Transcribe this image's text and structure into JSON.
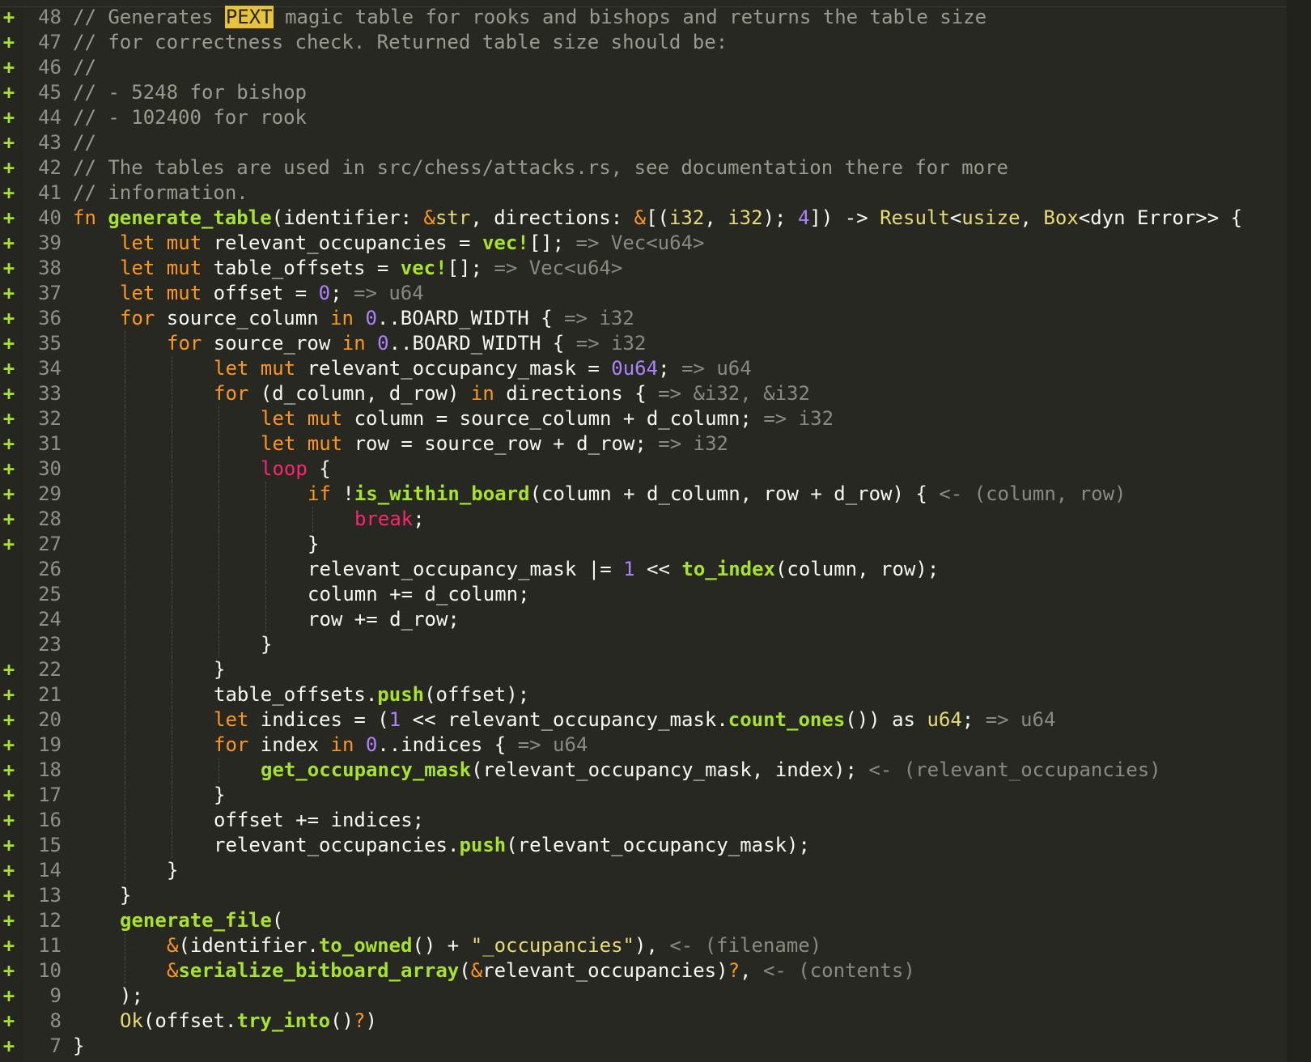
{
  "editor": {
    "colors": {
      "background": "#272822",
      "added_marker": "#a6e22e",
      "keyword": "#f92672",
      "function": "#a6e22e",
      "type": "#e6db74",
      "number": "#ae81ff",
      "comment": "#9a9a8e",
      "highlight": "#e6c33a"
    },
    "lines": [
      {
        "num": "48",
        "mark": "+",
        "indent": 0,
        "tokens": [
          [
            "com",
            "// Generates "
          ],
          [
            "hl",
            "PEXT"
          ],
          [
            "com",
            " magic table for rooks and bishops and returns the table size"
          ]
        ]
      },
      {
        "num": "47",
        "mark": "+",
        "indent": 0,
        "tokens": [
          [
            "com",
            "// for correctness check. Returned table size should be:"
          ]
        ]
      },
      {
        "num": "46",
        "mark": "+",
        "indent": 0,
        "tokens": [
          [
            "com",
            "//"
          ]
        ]
      },
      {
        "num": "45",
        "mark": "+",
        "indent": 0,
        "tokens": [
          [
            "com",
            "// - 5248 for bishop"
          ]
        ]
      },
      {
        "num": "44",
        "mark": "+",
        "indent": 0,
        "tokens": [
          [
            "com",
            "// - 102400 for rook"
          ]
        ]
      },
      {
        "num": "43",
        "mark": "+",
        "indent": 0,
        "tokens": [
          [
            "com",
            "//"
          ]
        ]
      },
      {
        "num": "42",
        "mark": "+",
        "indent": 0,
        "tokens": [
          [
            "com",
            "// The tables are used in src/chess/attacks.rs, see documentation there for more"
          ]
        ]
      },
      {
        "num": "41",
        "mark": "+",
        "indent": 0,
        "tokens": [
          [
            "com",
            "// information."
          ]
        ]
      },
      {
        "num": "40",
        "mark": "+",
        "indent": 0,
        "tokens": [
          [
            "kw2",
            "fn "
          ],
          [
            "fn",
            "generate_table"
          ],
          [
            "plain",
            "(identifier: "
          ],
          [
            "kw2",
            "&"
          ],
          [
            "ty",
            "str"
          ],
          [
            "plain",
            ", directions: "
          ],
          [
            "kw2",
            "&"
          ],
          [
            "plain",
            "[("
          ],
          [
            "ty",
            "i32"
          ],
          [
            "plain",
            ", "
          ],
          [
            "ty",
            "i32"
          ],
          [
            "plain",
            "); "
          ],
          [
            "num",
            "4"
          ],
          [
            "plain",
            "]) -> "
          ],
          [
            "ty",
            "Result"
          ],
          [
            "plain",
            "<"
          ],
          [
            "ty",
            "usize"
          ],
          [
            "plain",
            ", "
          ],
          [
            "ty",
            "Box"
          ],
          [
            "plain",
            "<dyn Error>> {"
          ]
        ]
      },
      {
        "num": "39",
        "mark": "+",
        "indent": 1,
        "tokens": [
          [
            "kw2",
            "let mut "
          ],
          [
            "plain",
            "relevant_occupancies = "
          ],
          [
            "fn",
            "vec!"
          ],
          [
            "plain",
            "[]; "
          ],
          [
            "hint",
            "=> Vec<u64>"
          ]
        ]
      },
      {
        "num": "38",
        "mark": "+",
        "indent": 1,
        "tokens": [
          [
            "kw2",
            "let mut "
          ],
          [
            "plain",
            "table_offsets = "
          ],
          [
            "fn",
            "vec!"
          ],
          [
            "plain",
            "[]; "
          ],
          [
            "hint",
            "=> Vec<u64>"
          ]
        ]
      },
      {
        "num": "37",
        "mark": "+",
        "indent": 1,
        "tokens": [
          [
            "kw2",
            "let mut "
          ],
          [
            "plain",
            "offset = "
          ],
          [
            "num",
            "0"
          ],
          [
            "plain",
            "; "
          ],
          [
            "hint",
            "=> u64"
          ]
        ]
      },
      {
        "num": "36",
        "mark": "+",
        "indent": 1,
        "tokens": [
          [
            "kw2",
            "for "
          ],
          [
            "plain",
            "source_column "
          ],
          [
            "kw2",
            "in "
          ],
          [
            "num",
            "0"
          ],
          [
            "plain",
            "..BOARD_WIDTH { "
          ],
          [
            "hint",
            "=> i32"
          ]
        ]
      },
      {
        "num": "35",
        "mark": "+",
        "indent": 2,
        "tokens": [
          [
            "kw2",
            "for "
          ],
          [
            "plain",
            "source_row "
          ],
          [
            "kw2",
            "in "
          ],
          [
            "num",
            "0"
          ],
          [
            "plain",
            "..BOARD_WIDTH { "
          ],
          [
            "hint",
            "=> i32"
          ]
        ]
      },
      {
        "num": "34",
        "mark": "+",
        "indent": 3,
        "tokens": [
          [
            "kw2",
            "let mut "
          ],
          [
            "plain",
            "relevant_occupancy_mask = "
          ],
          [
            "num",
            "0u64"
          ],
          [
            "plain",
            "; "
          ],
          [
            "hint",
            "=> u64"
          ]
        ]
      },
      {
        "num": "33",
        "mark": "+",
        "indent": 3,
        "tokens": [
          [
            "kw2",
            "for "
          ],
          [
            "plain",
            "(d_column, d_row) "
          ],
          [
            "kw2",
            "in "
          ],
          [
            "plain",
            "directions { "
          ],
          [
            "hint",
            "=> &i32, &i32"
          ]
        ]
      },
      {
        "num": "32",
        "mark": "+",
        "indent": 4,
        "tokens": [
          [
            "kw2",
            "let mut "
          ],
          [
            "plain",
            "column = source_column + d_column; "
          ],
          [
            "hint",
            "=> i32"
          ]
        ]
      },
      {
        "num": "31",
        "mark": "+",
        "indent": 4,
        "tokens": [
          [
            "kw2",
            "let mut "
          ],
          [
            "plain",
            "row = source_row + d_row; "
          ],
          [
            "hint",
            "=> i32"
          ]
        ]
      },
      {
        "num": "30",
        "mark": "+",
        "indent": 4,
        "tokens": [
          [
            "kw",
            "loop "
          ],
          [
            "plain",
            "{"
          ]
        ]
      },
      {
        "num": "29",
        "mark": "+",
        "indent": 5,
        "tokens": [
          [
            "kw2",
            "if "
          ],
          [
            "plain",
            "!"
          ],
          [
            "fn",
            "is_within_board"
          ],
          [
            "plain",
            "(column + d_column, row + d_row) { "
          ],
          [
            "hint",
            "<- (column, row)"
          ]
        ]
      },
      {
        "num": "28",
        "mark": "+",
        "indent": 6,
        "tokens": [
          [
            "kw",
            "break"
          ],
          [
            "plain",
            ";"
          ]
        ]
      },
      {
        "num": "27",
        "mark": "+",
        "indent": 5,
        "tokens": [
          [
            "plain",
            "}"
          ]
        ]
      },
      {
        "num": "26",
        "mark": "",
        "indent": 5,
        "tokens": [
          [
            "plain",
            "relevant_occupancy_mask |= "
          ],
          [
            "num",
            "1"
          ],
          [
            "plain",
            " << "
          ],
          [
            "fn",
            "to_index"
          ],
          [
            "plain",
            "(column, row);"
          ]
        ]
      },
      {
        "num": "25",
        "mark": "",
        "indent": 5,
        "tokens": [
          [
            "plain",
            "column += d_column;"
          ]
        ]
      },
      {
        "num": "24",
        "mark": "",
        "indent": 5,
        "tokens": [
          [
            "plain",
            "row += d_row;"
          ]
        ]
      },
      {
        "num": "23",
        "mark": "",
        "indent": 4,
        "tokens": [
          [
            "plain",
            "}"
          ]
        ]
      },
      {
        "num": "22",
        "mark": "+",
        "indent": 3,
        "tokens": [
          [
            "plain",
            "}"
          ]
        ]
      },
      {
        "num": "21",
        "mark": "+",
        "indent": 3,
        "tokens": [
          [
            "plain",
            "table_offsets."
          ],
          [
            "fn",
            "push"
          ],
          [
            "plain",
            "(offset);"
          ]
        ]
      },
      {
        "num": "20",
        "mark": "+",
        "indent": 3,
        "tokens": [
          [
            "kw2",
            "let "
          ],
          [
            "plain",
            "indices = ("
          ],
          [
            "num",
            "1"
          ],
          [
            "plain",
            " << relevant_occupancy_mask."
          ],
          [
            "fn",
            "count_ones"
          ],
          [
            "plain",
            "()) as "
          ],
          [
            "ty",
            "u64"
          ],
          [
            "plain",
            "; "
          ],
          [
            "hint",
            "=> u64"
          ]
        ]
      },
      {
        "num": "19",
        "mark": "+",
        "indent": 3,
        "tokens": [
          [
            "kw2",
            "for "
          ],
          [
            "plain",
            "index "
          ],
          [
            "kw2",
            "in "
          ],
          [
            "num",
            "0"
          ],
          [
            "plain",
            "..indices { "
          ],
          [
            "hint",
            "=> u64"
          ]
        ]
      },
      {
        "num": "18",
        "mark": "+",
        "indent": 4,
        "tokens": [
          [
            "fn",
            "get_occupancy_mask"
          ],
          [
            "plain",
            "(relevant_occupancy_mask, index); "
          ],
          [
            "hint",
            "<- (relevant_occupancies)"
          ]
        ]
      },
      {
        "num": "17",
        "mark": "+",
        "indent": 3,
        "tokens": [
          [
            "plain",
            "}"
          ]
        ]
      },
      {
        "num": "16",
        "mark": "+",
        "indent": 3,
        "tokens": [
          [
            "plain",
            "offset += indices;"
          ]
        ]
      },
      {
        "num": "15",
        "mark": "+",
        "indent": 3,
        "tokens": [
          [
            "plain",
            "relevant_occupancies."
          ],
          [
            "fn",
            "push"
          ],
          [
            "plain",
            "(relevant_occupancy_mask);"
          ]
        ]
      },
      {
        "num": "14",
        "mark": "+",
        "indent": 2,
        "tokens": [
          [
            "plain",
            "}"
          ]
        ]
      },
      {
        "num": "13",
        "mark": "+",
        "indent": 1,
        "tokens": [
          [
            "plain",
            "}"
          ]
        ]
      },
      {
        "num": "12",
        "mark": "+",
        "indent": 1,
        "tokens": [
          [
            "fn",
            "generate_file"
          ],
          [
            "plain",
            "("
          ]
        ]
      },
      {
        "num": "11",
        "mark": "+",
        "indent": 2,
        "tokens": [
          [
            "kw2",
            "&"
          ],
          [
            "plain",
            "(identifier."
          ],
          [
            "fn",
            "to_owned"
          ],
          [
            "plain",
            "() + "
          ],
          [
            "str",
            "\"_occupancies\""
          ],
          [
            "plain",
            "), "
          ],
          [
            "hint",
            "<- (filename)"
          ]
        ]
      },
      {
        "num": "10",
        "mark": "+",
        "indent": 2,
        "tokens": [
          [
            "kw2",
            "&"
          ],
          [
            "fn",
            "serialize_bitboard_array"
          ],
          [
            "plain",
            "("
          ],
          [
            "kw2",
            "&"
          ],
          [
            "plain",
            "relevant_occupancies)"
          ],
          [
            "kw2",
            "?"
          ],
          [
            "plain",
            ", "
          ],
          [
            "hint",
            "<- (contents)"
          ]
        ]
      },
      {
        "num": "9",
        "mark": "+",
        "indent": 1,
        "tokens": [
          [
            "plain",
            ");"
          ]
        ]
      },
      {
        "num": "8",
        "mark": "+",
        "indent": 1,
        "tokens": [
          [
            "ty",
            "Ok"
          ],
          [
            "plain",
            "(offset."
          ],
          [
            "fn",
            "try_into"
          ],
          [
            "plain",
            "()"
          ],
          [
            "kw2",
            "?"
          ],
          [
            "plain",
            ")"
          ]
        ]
      },
      {
        "num": "7",
        "mark": "+",
        "indent": 0,
        "tokens": [
          [
            "plain",
            "}"
          ]
        ]
      }
    ]
  }
}
